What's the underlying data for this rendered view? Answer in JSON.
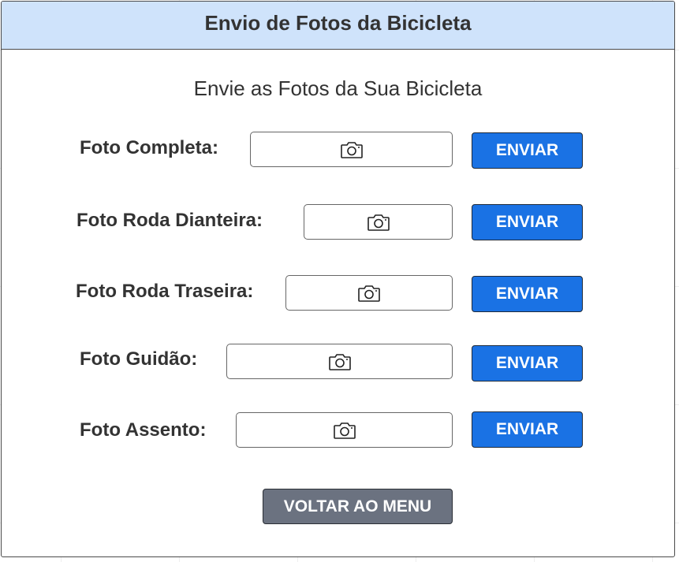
{
  "header": {
    "title": "Envio de Fotos da Bicicleta"
  },
  "subtitle": "Envie as Fotos da Sua Bicicleta",
  "photo_rows": [
    {
      "label": "Foto Completa:",
      "upload_icon": "camera-icon",
      "button_label": "ENVIAR"
    },
    {
      "label": "Foto Roda Dianteira:",
      "upload_icon": "camera-icon",
      "button_label": "ENVIAR"
    },
    {
      "label": "Foto Roda Traseira:",
      "upload_icon": "camera-icon",
      "button_label": "ENVIAR"
    },
    {
      "label": "Foto Guidão:",
      "upload_icon": "camera-icon",
      "button_label": "ENVIAR"
    },
    {
      "label": "Foto Assento:",
      "upload_icon": "camera-icon",
      "button_label": "ENVIAR"
    }
  ],
  "back_button_label": "VOLTAR AO MENU",
  "colors": {
    "header_background": "#cfe3fb",
    "send_button": "#1a72e4",
    "back_button": "#6b7280"
  }
}
